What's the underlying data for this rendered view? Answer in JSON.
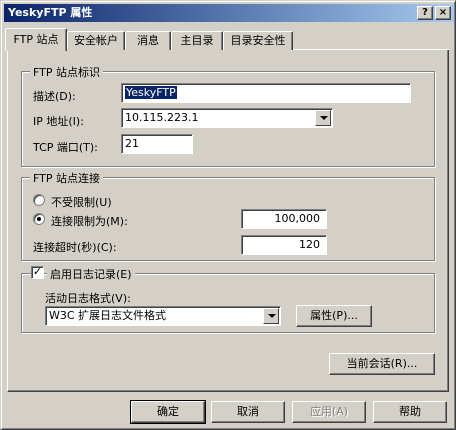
{
  "window": {
    "title": "YeskyFTP 属性",
    "help_btn": "?",
    "close_btn": "×"
  },
  "tabs": [
    {
      "label": "FTP 站点",
      "active": true
    },
    {
      "label": "安全帐户"
    },
    {
      "label": "消息"
    },
    {
      "label": "主目录"
    },
    {
      "label": "目录安全性"
    }
  ],
  "site_identity": {
    "group_label": "FTP 站点标识",
    "description_label": "描述(D):",
    "description_value": "YeskyFTP",
    "ip_label": "IP 地址(I):",
    "ip_value": "10.115.223.1",
    "port_label": "TCP 端口(T):",
    "port_value": "21"
  },
  "connections": {
    "group_label": "FTP 站点连接",
    "unlimited_label": "不受限制(U)",
    "limited_label": "连接限制为(M):",
    "limited_value": "100,000",
    "timeout_label": "连接超时(秒)(C):",
    "timeout_value": "120"
  },
  "logging": {
    "checkbox_label": "启用日志记录(E)",
    "checked_mark": "✓",
    "format_label": "活动日志格式(V):",
    "format_value": "W3C 扩展日志文件格式",
    "properties_button": "属性(P)..."
  },
  "current_sessions_button": "当前会话(R)...",
  "footer": {
    "ok": "确定",
    "cancel": "取消",
    "apply": "应用(A)",
    "help": "帮助"
  }
}
